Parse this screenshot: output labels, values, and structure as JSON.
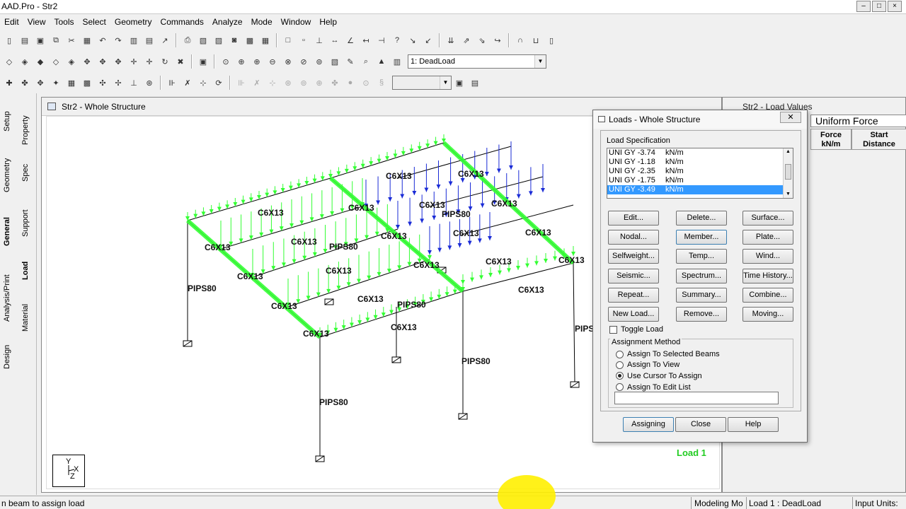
{
  "window": {
    "title": "AAD.Pro - Str2"
  },
  "menu": [
    "Edit",
    "View",
    "Tools",
    "Select",
    "Geometry",
    "Commands",
    "Analyze",
    "Mode",
    "Window",
    "Help"
  ],
  "toolbar": {
    "load_case_combo": "1: DeadLoad"
  },
  "left_tabs": [
    "Setup",
    "Geometry",
    "General",
    "Analysis/Print",
    "Design",
    "Property",
    "Spec",
    "Support",
    "Load",
    "Material"
  ],
  "structure_window": {
    "title": "Str2 - Whole Structure",
    "labels": [
      "C6X13",
      "C6X13",
      "C6X13",
      "C6X13",
      "C6X13",
      "C6X13",
      "C6X13",
      "C6X13",
      "C6X13",
      "C6X13",
      "C6X13",
      "C6X13",
      "C6X13",
      "C6X13",
      "C6X13",
      "C6X13",
      "C6X13",
      "PIPS80",
      "PIPS80",
      "PIPS80",
      "PIPS80",
      "PIPS80",
      "PIPS80",
      "PIPS"
    ],
    "load_label": "Load 1",
    "axis": {
      "y": "Y",
      "x": "X",
      "z": "Z"
    }
  },
  "load_values_window": {
    "title": "Str2 - Load Values",
    "tab": "Uniform Force",
    "headers": [
      "Force\nkN/m",
      "Start\nDistance"
    ]
  },
  "loads_dialog": {
    "title": "Loads - Whole Structure",
    "close": "✕",
    "load_spec_label": "Load Specification",
    "loads": [
      {
        "value": "UNI GY -3.74",
        "unit": "kN/m"
      },
      {
        "value": "UNI GY -1.18",
        "unit": "kN/m"
      },
      {
        "value": "UNI GY -2.35",
        "unit": "kN/m"
      },
      {
        "value": "UNI GY -1.75",
        "unit": "kN/m"
      },
      {
        "value": "UNI GY -3.49",
        "unit": "kN/m"
      }
    ],
    "selected_index": 4,
    "buttons": [
      [
        "Edit...",
        "Delete...",
        "Surface..."
      ],
      [
        "Nodal...",
        "Member...",
        "Plate..."
      ],
      [
        "Selfweight...",
        "Temp...",
        "Wind..."
      ],
      [
        "Seismic...",
        "Spectrum...",
        "Time History..."
      ],
      [
        "Repeat...",
        "Summary...",
        "Combine..."
      ],
      [
        "New Load...",
        "Remove...",
        "Moving..."
      ]
    ],
    "toggle_load": "Toggle Load",
    "assignment_method_label": "Assignment Method",
    "assignment_options": [
      "Assign To Selected Beams",
      "Assign To View",
      "Use Cursor To Assign",
      "Assign To Edit List"
    ],
    "selected_assignment": 2,
    "bottom_buttons": [
      "Assigning",
      "Close",
      "Help"
    ]
  },
  "statusbar": {
    "left": "n beam to assign load",
    "mode": "Modeling Mo",
    "load": "Load 1 : DeadLoad",
    "units": "Input Units:"
  },
  "colors": {
    "green_load": "#33ff33",
    "blue_load": "#1a2bd6",
    "selection": "#3399ff"
  }
}
